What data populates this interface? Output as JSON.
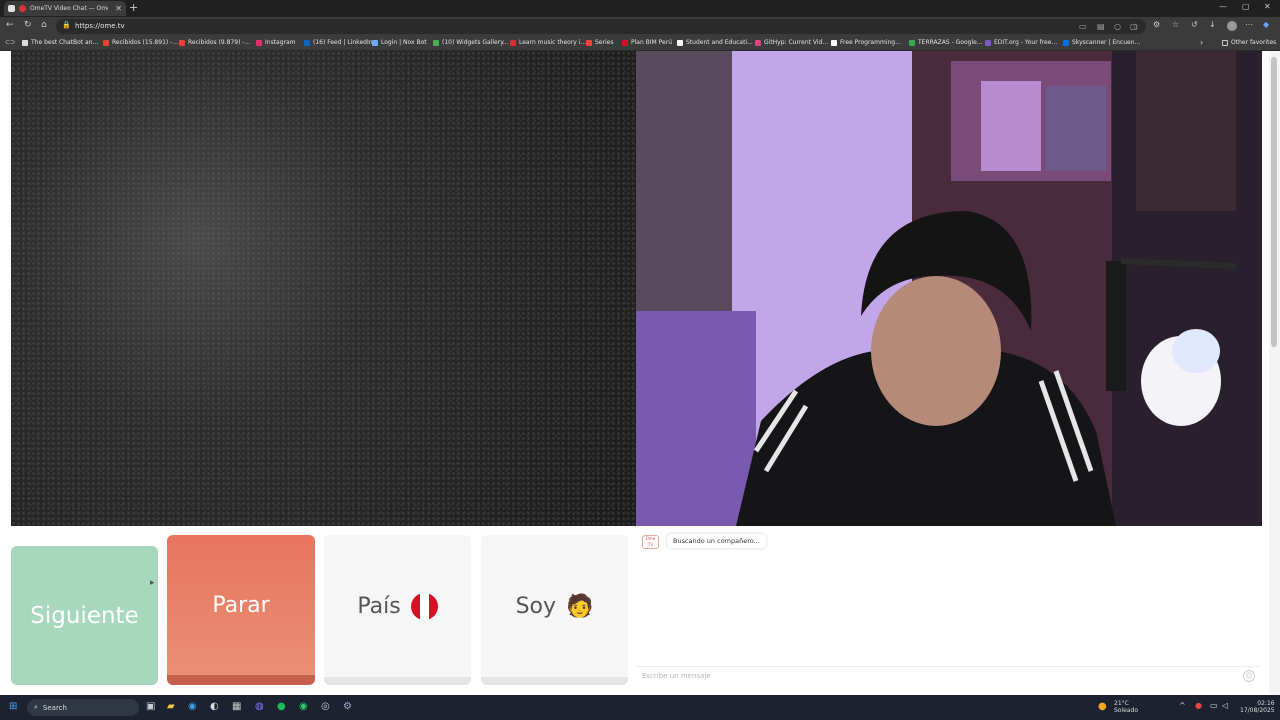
{
  "browser": {
    "tab_title": "OmeTV Video Chat — Ome",
    "tab_close": "✕",
    "new_tab": "+",
    "url": "https://ome.tv",
    "window_controls": [
      "—",
      "▢",
      "✕"
    ]
  },
  "bookmarks": [
    {
      "label": "The best ChatBot an...",
      "color": "#dddddd"
    },
    {
      "label": "Recibidos (15.891) -...",
      "color": "#ea4335"
    },
    {
      "label": "Recibidos (9.879) -...",
      "color": "#ea4335"
    },
    {
      "label": "Instagram",
      "color": "#e1306c"
    },
    {
      "label": "(16) Feed | LinkedIn",
      "color": "#0a66c2"
    },
    {
      "label": "Login | Nox Bot",
      "color": "#6aa9ff"
    },
    {
      "label": "(10) Widgets Gallery...",
      "color": "#4caf50"
    },
    {
      "label": "Learn music theory i...",
      "color": "#d32f2f"
    },
    {
      "label": "Series",
      "color": "#ff3d3d"
    },
    {
      "label": "Plan BIM Perú",
      "color": "#d91023"
    },
    {
      "label": "Student and Educati...",
      "color": "#ffffff"
    },
    {
      "label": "GitHyp: Current Vid...",
      "color": "#e0407b"
    },
    {
      "label": "Free Programming...",
      "color": "#ffffff"
    },
    {
      "label": "TERRAZAS - Google...",
      "color": "#34a853"
    },
    {
      "label": "EDIT.org - Your free...",
      "color": "#7e57c2"
    },
    {
      "label": "Skyscanner | Encuen...",
      "color": "#0770e3"
    }
  ],
  "other_favorites": "Other favorites",
  "controls": {
    "siguiente": "Siguiente",
    "parar": "Parar",
    "pais": "País",
    "soy": "Soy",
    "soy_emoji": "🧑"
  },
  "chat": {
    "logo_text": "Ome TV",
    "status": "Buscando un compañero...",
    "input_placeholder": "Escribe un mensaje"
  },
  "taskbar": {
    "search_placeholder": "Search",
    "weather_temp": "21°C",
    "weather_desc": "Soleado",
    "time": "02:16",
    "date": "17/08/2025"
  }
}
